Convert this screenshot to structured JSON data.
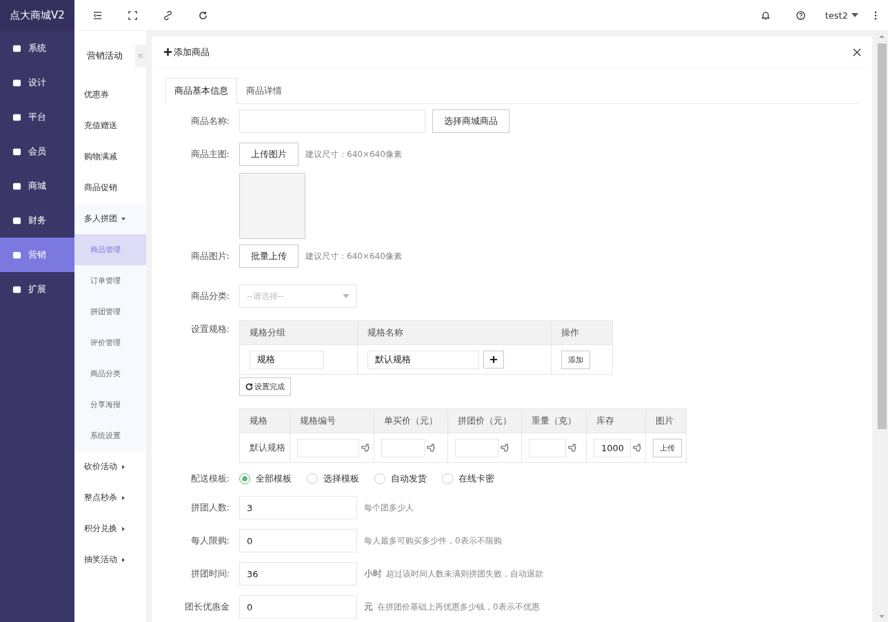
{
  "brand": "点大商城V2",
  "nav": [
    {
      "label": "系统",
      "selected": false
    },
    {
      "label": "设计",
      "selected": false
    },
    {
      "label": "平台",
      "selected": false
    },
    {
      "label": "会员",
      "selected": false
    },
    {
      "label": "商城",
      "selected": false
    },
    {
      "label": "财务",
      "selected": false
    },
    {
      "label": "营销",
      "selected": true
    },
    {
      "label": "扩展",
      "selected": false
    }
  ],
  "user": "test2",
  "subnav": {
    "title": "营销活动",
    "items": [
      {
        "label": "优惠券",
        "kind": "link"
      },
      {
        "label": "充值赠送",
        "kind": "link"
      },
      {
        "label": "购物满减",
        "kind": "link"
      },
      {
        "label": "商品促销",
        "kind": "link"
      },
      {
        "label": "多人拼团",
        "kind": "group",
        "expanded": true,
        "children": [
          {
            "label": "商品管理",
            "selected": true
          },
          {
            "label": "订单管理",
            "selected": false
          },
          {
            "label": "拼团管理",
            "selected": false
          },
          {
            "label": "评价管理",
            "selected": false
          },
          {
            "label": "商品分类",
            "selected": false
          },
          {
            "label": "分享海报",
            "selected": false
          },
          {
            "label": "系统设置",
            "selected": false
          }
        ]
      },
      {
        "label": "砍价活动",
        "kind": "group",
        "expanded": false
      },
      {
        "label": "整点秒杀",
        "kind": "group",
        "expanded": false
      },
      {
        "label": "积分兑换",
        "kind": "group",
        "expanded": false
      },
      {
        "label": "抽奖活动",
        "kind": "group",
        "expanded": false
      }
    ]
  },
  "panel": {
    "title": "添加商品",
    "tabs": [
      {
        "label": "商品基本信息",
        "selected": true
      },
      {
        "label": "商品详情",
        "selected": false
      }
    ],
    "name": {
      "label": "商品名称:",
      "button": "选择商城商品"
    },
    "main_image": {
      "label": "商品主图:",
      "button": "上传图片",
      "hint": "建议尺寸：640×640像素"
    },
    "images": {
      "label": "商品图片:",
      "button": "批量上传",
      "hint": "建议尺寸：640×640像素"
    },
    "category": {
      "label": "商品分类:",
      "placeholder": "--请选择--"
    },
    "spec": {
      "label": "设置规格:",
      "columns": [
        "规格分组",
        "规格名称",
        "操作"
      ],
      "group_value": "规格",
      "name_value": "默认规格",
      "add_button": "添加",
      "done_button": "设置完成"
    },
    "sku": {
      "columns": [
        "规格",
        "规格编号",
        "单买价（元）",
        "拼团价（元）",
        "重量（克）",
        "库存",
        "图片"
      ],
      "row": {
        "name": "默认规格",
        "stock": "1000",
        "upload": "上传"
      }
    },
    "delivery": {
      "label": "配送模板:",
      "options": [
        {
          "label": "全部模板",
          "selected": true
        },
        {
          "label": "选择模板",
          "selected": false
        },
        {
          "label": "自动发货",
          "selected": false
        },
        {
          "label": "在线卡密",
          "selected": false
        }
      ]
    },
    "fields": [
      {
        "label": "拼团人数:",
        "value": "3",
        "hint": "每个团多少人"
      },
      {
        "label": "每人限购:",
        "value": "0",
        "hint": "每人最多可购买多少件，0表示不限购"
      },
      {
        "label": "拼团时间:",
        "value": "36",
        "unit": "小时",
        "hint": "超过该时间人数未满则拼团失败，自动退款"
      },
      {
        "label": "团长优惠金",
        "value": "0",
        "unit": "元",
        "hint": "在拼团价基础上再优惠多少钱，0表示不优惠"
      }
    ]
  }
}
